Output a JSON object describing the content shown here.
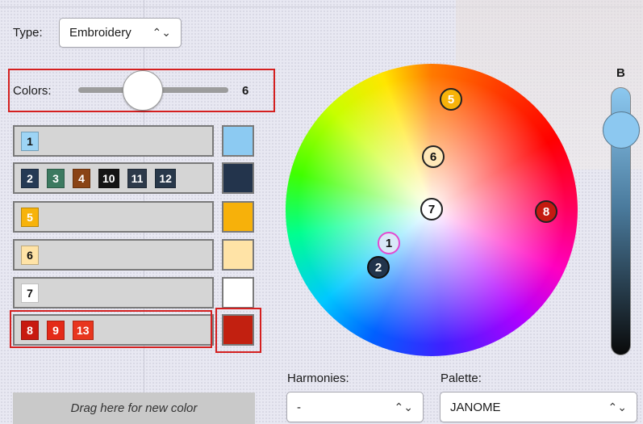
{
  "type_field": {
    "label": "Type:",
    "value": "Embroidery"
  },
  "colors_field": {
    "label": "Colors:",
    "value": "6"
  },
  "color_rows": [
    {
      "chips": [
        {
          "n": "1",
          "bg": "#9dd4f5",
          "fg": "#111111"
        }
      ],
      "swatch": "#8ccaf2"
    },
    {
      "chips": [
        {
          "n": "2",
          "bg": "#253a55",
          "fg": "#ffffff"
        },
        {
          "n": "3",
          "bg": "#3c7a60",
          "fg": "#ffffff"
        },
        {
          "n": "4",
          "bg": "#8a4416",
          "fg": "#ffffff"
        },
        {
          "n": "10",
          "bg": "#141414",
          "fg": "#ffffff"
        },
        {
          "n": "11",
          "bg": "#2d3a4a",
          "fg": "#ffffff"
        },
        {
          "n": "12",
          "bg": "#28384a",
          "fg": "#ffffff"
        }
      ],
      "swatch": "#23344c"
    },
    {
      "chips": [
        {
          "n": "5",
          "bg": "#f7b30a",
          "fg": "#ffffff"
        }
      ],
      "swatch": "#f7b10a"
    },
    {
      "chips": [
        {
          "n": "6",
          "bg": "#ffe3a6",
          "fg": "#111111"
        }
      ],
      "swatch": "#ffe3a6"
    },
    {
      "chips": [
        {
          "n": "7",
          "bg": "#ffffff",
          "fg": "#111111"
        }
      ],
      "swatch": "#ffffff"
    },
    {
      "chips": [
        {
          "n": "8",
          "bg": "#c81a10",
          "fg": "#ffffff"
        },
        {
          "n": "9",
          "bg": "#e42a18",
          "fg": "#ffffff"
        },
        {
          "n": "13",
          "bg": "#e8361e",
          "fg": "#ffffff"
        }
      ],
      "swatch": "#c22010"
    }
  ],
  "drop_zone": {
    "label": "Drag here for new color"
  },
  "wheel_markers": [
    {
      "n": "1",
      "bg": "#d9e8f8",
      "fg": "#111111",
      "border": "#e34bd0"
    },
    {
      "n": "2",
      "bg": "#22344c",
      "fg": "#ffffff",
      "border": "#111111"
    },
    {
      "n": "5",
      "bg": "#f7b30a",
      "fg": "#ffffff",
      "border": "#222222"
    },
    {
      "n": "6",
      "bg": "#ffe8b8",
      "fg": "#111111",
      "border": "#222222"
    },
    {
      "n": "7",
      "bg": "#ffffff",
      "fg": "#111111",
      "border": "#222222"
    },
    {
      "n": "8",
      "bg": "#c41a10",
      "fg": "#ffffff",
      "border": "#222222"
    }
  ],
  "brightness": {
    "label": "B"
  },
  "harmonies": {
    "label": "Harmonies:",
    "value": "-"
  },
  "palette": {
    "label": "Palette:",
    "value": "JANOME"
  },
  "colors": {
    "highlight": "#d42020",
    "row_border": "#7a7a7a"
  }
}
